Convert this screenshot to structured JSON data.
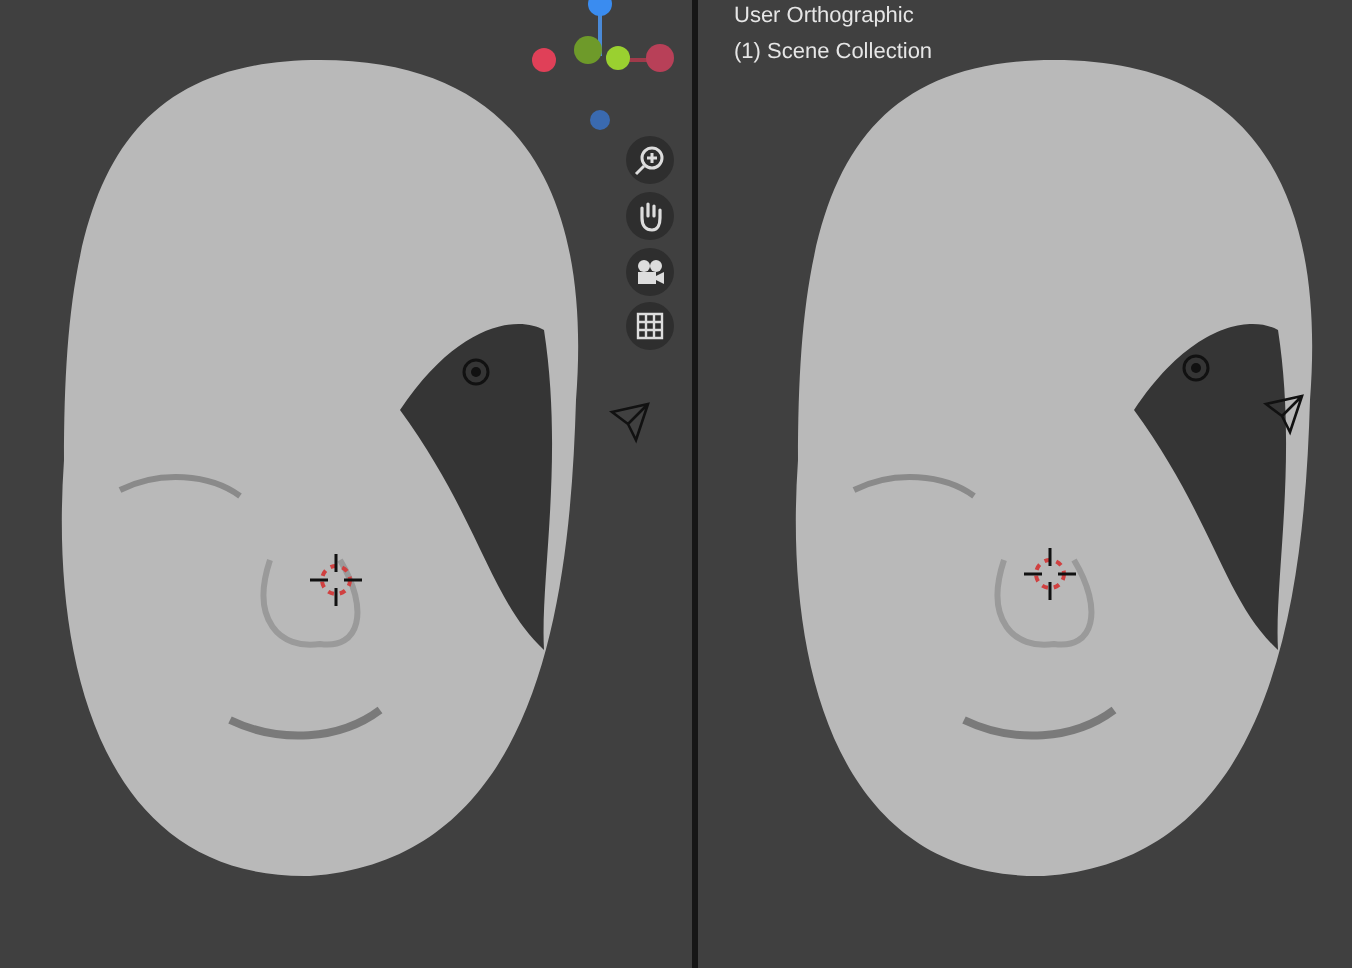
{
  "viewports": [
    {
      "kind": "navigation"
    },
    {
      "kind": "info",
      "view_name": "User Orthographic",
      "collection": "(1) Scene Collection"
    }
  ]
}
